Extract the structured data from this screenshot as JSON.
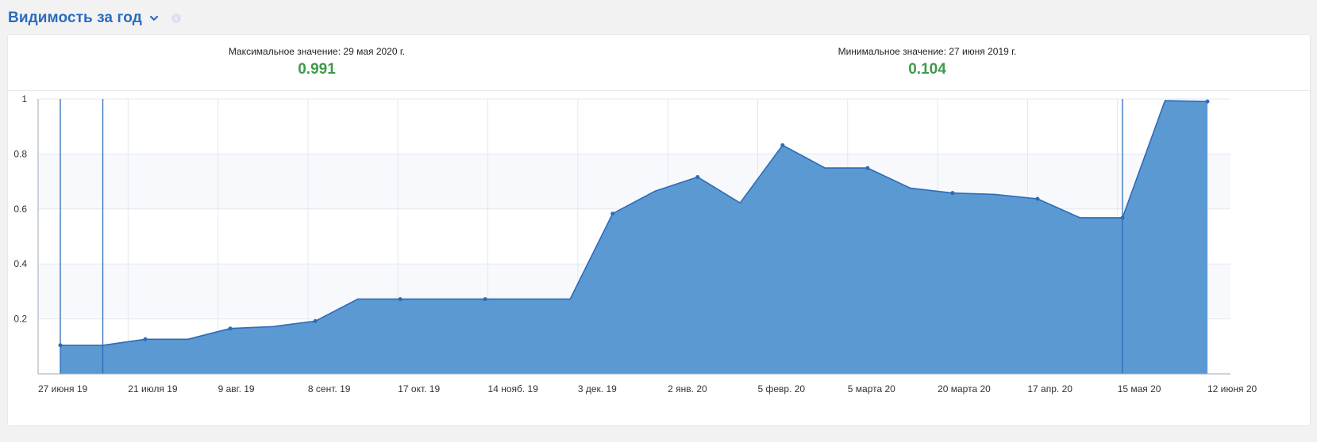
{
  "header": {
    "title": "Видимость за год"
  },
  "stats": {
    "max_label": "Максимальное значение: 29 мая 2020 г.",
    "max_value": "0.991",
    "min_label": "Минимальное значение: 27 июня 2019 г.",
    "min_value": "0.104"
  },
  "colors": {
    "area": "#5b99d3",
    "line": "#2f6bb6",
    "value": "#3f9a4a",
    "title": "#2b6bbf"
  },
  "chart_data": {
    "type": "area",
    "title": "",
    "xlabel": "",
    "ylabel": "",
    "ylim": [
      0,
      1
    ],
    "y_ticks": [
      0.2,
      0.4,
      0.6,
      0.8,
      1
    ],
    "grid": true,
    "x_tick_labels": [
      "27 июня 19",
      "21 июля 19",
      "9 авг. 19",
      "8 сент. 19",
      "17 окт. 19",
      "14 нояб. 19",
      "3 дек. 19",
      "2 янв. 20",
      "5 февр. 20",
      "5 марта 20",
      "20 марта 20",
      "17 апр. 20",
      "15 мая 20",
      "12 июня 20"
    ],
    "series": [
      {
        "values": [
          0.104,
          0.104,
          0.126,
          0.126,
          0.165,
          0.172,
          0.192,
          0.272,
          0.272,
          0.272,
          0.272,
          0.272,
          0.272,
          0.583,
          0.665,
          0.716,
          0.622,
          0.832,
          0.749,
          0.749,
          0.676,
          0.658,
          0.653,
          0.637,
          0.568,
          0.568,
          0.994,
          0.991
        ],
        "markers": [
          0,
          2,
          4,
          6,
          8,
          10,
          13,
          15,
          17,
          19,
          21,
          23,
          25,
          27
        ]
      }
    ],
    "annotations": [
      {
        "type": "vertical-line",
        "x_index": 0
      },
      {
        "type": "vertical-line",
        "x_index": 1
      },
      {
        "type": "vertical-line",
        "x_index": 25
      }
    ]
  }
}
